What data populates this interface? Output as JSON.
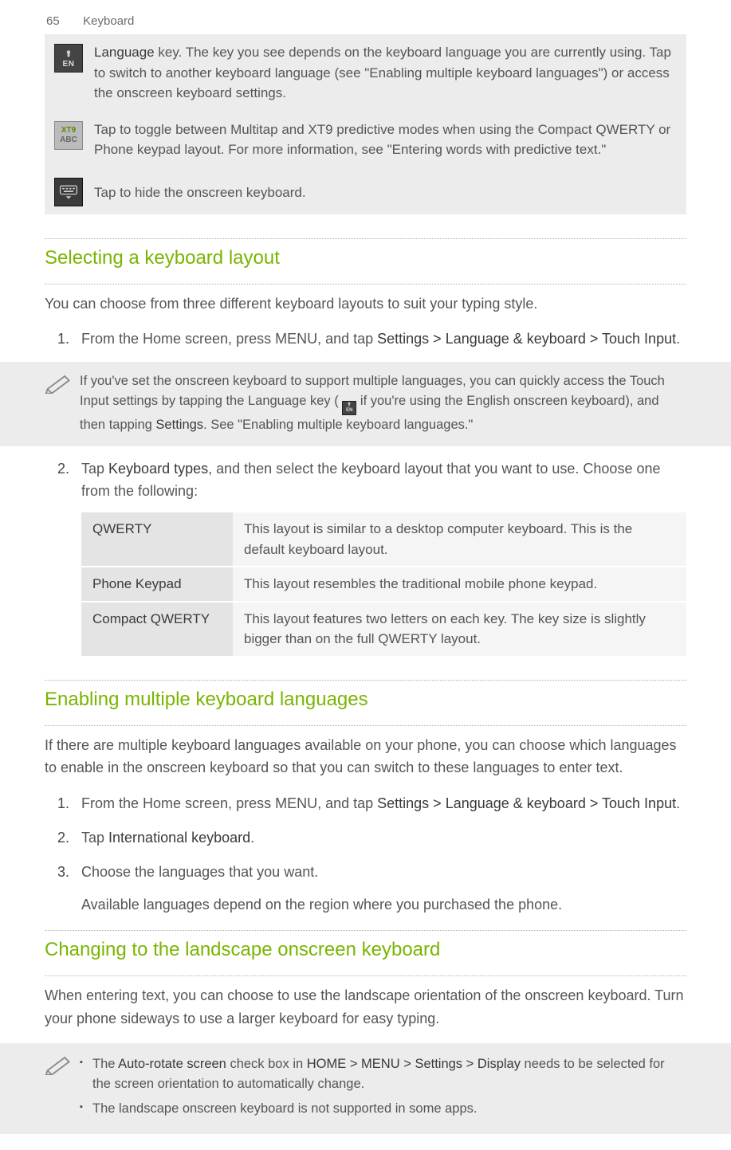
{
  "header": {
    "page_num": "65",
    "section": "Keyboard"
  },
  "key_table": {
    "row1": {
      "before_hl": "",
      "hl": "Language",
      "after_hl": " key. The key you see depends on the keyboard language you are currently using. Tap to switch to another keyboard language (see \"Enabling multiple keyboard languages\") or access the onscreen keyboard settings."
    },
    "row2": {
      "text": "Tap to toggle between Multitap and XT9 predictive modes when using the Compact QWERTY or Phone keypad layout. For more information, see \"Entering words with predictive text.\""
    },
    "row3": {
      "text": "Tap to hide the onscreen keyboard."
    },
    "icon_labels": {
      "xt9_top": "XT9",
      "xt9_bottom": "ABC",
      "en_label": "EN"
    }
  },
  "section1": {
    "title": "Selecting a keyboard layout",
    "intro": "You can choose from three different keyboard layouts to suit your typing style.",
    "step1": {
      "num": "1.",
      "before": "From the Home screen, press MENU, and tap ",
      "dark": "Settings > Language & keyboard > Touch Input",
      "after": "."
    },
    "note": {
      "before": "If you've set the onscreen keyboard to support multiple languages, you can quickly access the Touch Input settings by tapping the Language key ( ",
      "after1": " if you're using the English onscreen keyboard), and then tapping ",
      "dark": "Settings",
      "after2": ". See \"Enabling multiple keyboard languages.\""
    },
    "step2": {
      "num": "2.",
      "before": "Tap ",
      "dark": "Keyboard types",
      "after": ", and then select the keyboard layout that you want to use. Choose one from the following:"
    },
    "table": {
      "r1": {
        "label": "QWERTY",
        "desc": "This layout is similar to a desktop computer keyboard. This is the default keyboard layout."
      },
      "r2": {
        "label": "Phone Keypad",
        "desc": "This layout resembles the traditional mobile phone keypad."
      },
      "r3": {
        "label": "Compact QWERTY",
        "desc": "This layout features two letters on each key. The key size is slightly bigger than on the full QWERTY layout."
      }
    }
  },
  "section2": {
    "title": "Enabling multiple keyboard languages",
    "intro": "If there are multiple keyboard languages available on your phone, you can choose which languages to enable in the onscreen keyboard so that you can switch to these languages to enter text.",
    "step1": {
      "num": "1.",
      "before": "From the Home screen, press MENU, and tap ",
      "dark": "Settings > Language & keyboard > Touch Input",
      "after": "."
    },
    "step2": {
      "num": "2.",
      "before": "Tap ",
      "dark": "International keyboard",
      "after": "."
    },
    "step3": {
      "num": "3.",
      "text": "Choose the languages that you want.",
      "sub": "Available languages depend on the region where you purchased the phone."
    }
  },
  "section3": {
    "title": "Changing to the landscape onscreen keyboard",
    "intro": "When entering text, you can choose to use the landscape orientation of the onscreen keyboard. Turn your phone sideways to use a larger keyboard for easy typing.",
    "note": {
      "b1": {
        "before": "The ",
        "dark1": "Auto-rotate screen",
        "mid": " check box in ",
        "dark2": "HOME > MENU > Settings > Display",
        "after": " needs to be selected for the screen orientation to automatically change."
      },
      "b2": "The landscape onscreen keyboard is not supported in some apps."
    }
  }
}
